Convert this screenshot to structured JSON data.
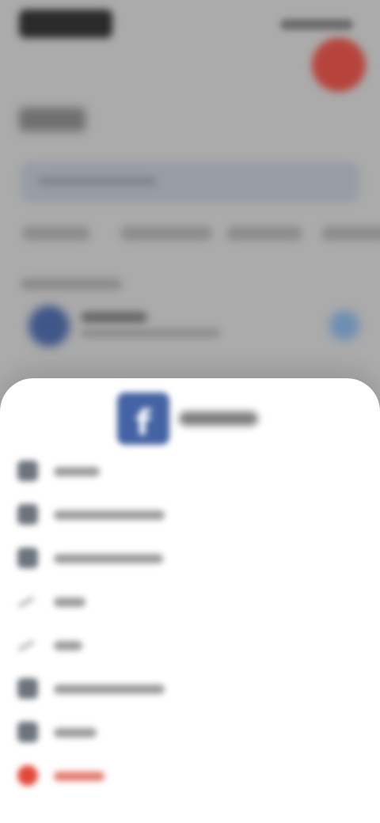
{
  "status_bar": {
    "time": "",
    "icons": [
      "signal-icon",
      "wifi-icon",
      "battery-icon"
    ]
  },
  "header": {
    "title": "",
    "avatar_color": "#b6443c"
  },
  "search": {
    "placeholder": ""
  },
  "filters": {
    "chips": [
      {
        "label": ""
      },
      {
        "label": ""
      },
      {
        "label": ""
      },
      {
        "label": ""
      }
    ]
  },
  "section": {
    "label": ""
  },
  "account": {
    "name": "",
    "subtitle": "",
    "logo_color": "#3f5688",
    "action_icon": "info-icon"
  },
  "sheet": {
    "logo_glyph": "f",
    "logo_color": "#4463a4",
    "title": "",
    "items": [
      {
        "label": "",
        "icon": "globe-icon"
      },
      {
        "label": "",
        "icon": "copy-icon"
      },
      {
        "label": "",
        "icon": "copy-icon"
      },
      {
        "label": "",
        "icon": "edit-icon"
      },
      {
        "label": "",
        "icon": "share-icon"
      },
      {
        "label": "",
        "icon": "key-icon"
      },
      {
        "label": "",
        "icon": "archive-icon"
      },
      {
        "label": "",
        "icon": "delete-icon"
      }
    ],
    "danger_color": "#e2483c"
  }
}
